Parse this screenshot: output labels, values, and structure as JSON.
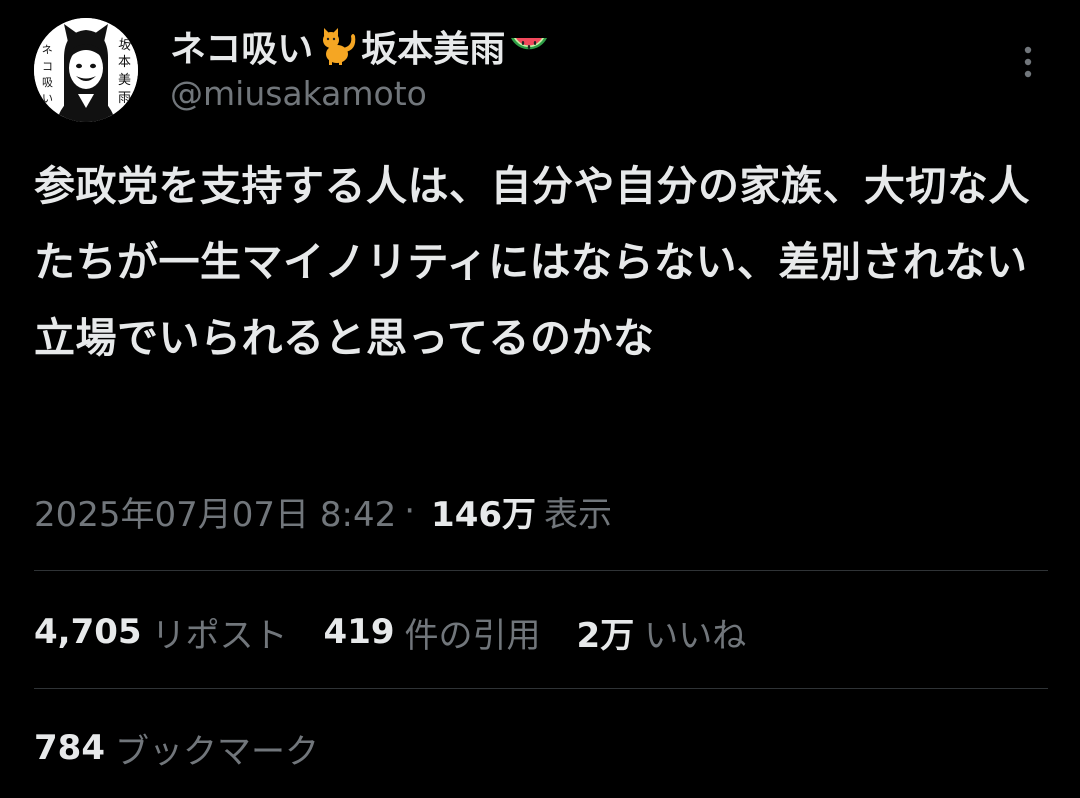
{
  "author": {
    "display_name_part1": "ネコ吸い",
    "display_name_part2": "坂本美雨",
    "handle": "@miusakamoto",
    "avatar_text": "坂本美雨",
    "avatar_text2": "ネコ吸い",
    "emoji_cat": "cat-emoji",
    "emoji_watermelon": "watermelon-emoji"
  },
  "tweet": {
    "text": "参政党を支持する人は、自分や自分の家族、大切な人たちが一生マイノリティにはならない、差別されない立場でいられると思ってるのかな",
    "timestamp": "2025年07月07日 8:42",
    "separator": "·",
    "views_count": "146万",
    "views_label": "表示"
  },
  "stats": {
    "reposts_count": "4,705",
    "reposts_label": "リポスト",
    "quotes_count": "419",
    "quotes_label": "件の引用",
    "likes_count": "2万",
    "likes_label": "いいね",
    "bookmarks_count": "784",
    "bookmarks_label": "ブックマーク"
  },
  "icons": {
    "more": "more-vertical-icon"
  },
  "colors": {
    "background": "#000000",
    "primary_text": "#e7e9ea",
    "secondary_text": "#71767b",
    "divider": "#2f3336"
  }
}
